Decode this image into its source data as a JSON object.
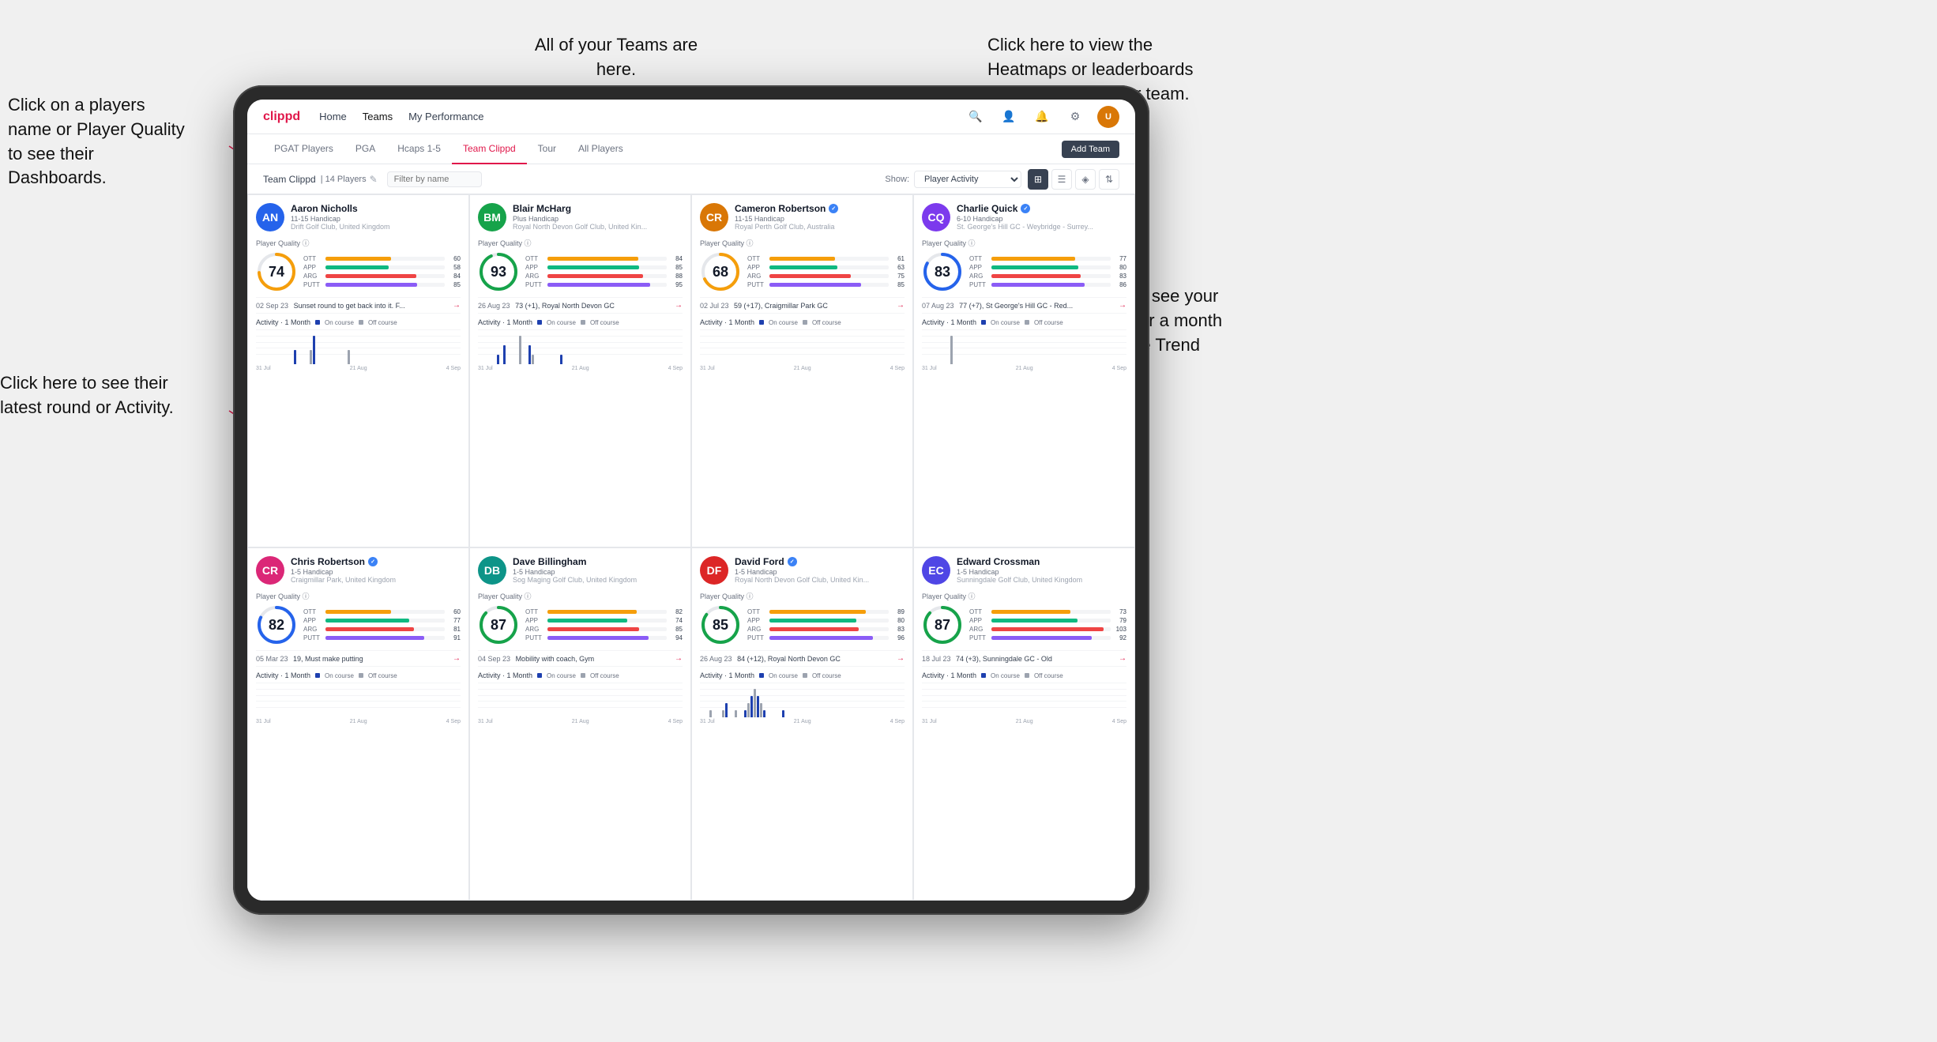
{
  "annotations": {
    "click_player": "Click on a players name\nor Player Quality to see\ntheir Dashboards.",
    "click_round": "Click here to see their latest\nround or Activity.",
    "teams_here": "All of your Teams are here.",
    "heatmaps": "Click here to view the\nHeatmaps or leaderboards\nand streaks for your team.",
    "activities": "Choose whether you see\nyour players Activities over\na month or their Quality\nScore Trend over a year."
  },
  "nav": {
    "logo": "clippd",
    "items": [
      "Home",
      "Teams",
      "My Performance"
    ],
    "active": "Teams"
  },
  "sub_tabs": {
    "items": [
      "PGAT Players",
      "PGA",
      "Hcaps 1-5",
      "Team Clippd",
      "Tour",
      "All Players"
    ],
    "active": "Team Clippd",
    "add_button": "Add Team"
  },
  "filter_bar": {
    "team_label": "Team Clippd",
    "separator": "|",
    "count": "14 Players",
    "search_placeholder": "Filter by name",
    "show_label": "Show:",
    "show_value": "Player Activity"
  },
  "players": [
    {
      "name": "Aaron Nicholls",
      "handicap": "11-15 Handicap",
      "club": "Drift Golf Club, United Kingdom",
      "verified": false,
      "quality": 74,
      "color": "#2563eb",
      "ott": 60,
      "app": 58,
      "arg": 84,
      "putt": 85,
      "recent_date": "02 Sep 23",
      "recent_text": "Sunset round to get back into it. F...",
      "bars": [
        0,
        0,
        0,
        0,
        0,
        0,
        0,
        0,
        0,
        0,
        0,
        0,
        1,
        0,
        0,
        0,
        0,
        1,
        2,
        0,
        0,
        0,
        0,
        0,
        0,
        0,
        0,
        0,
        0,
        1
      ],
      "chart_labels": [
        "31 Jul",
        "21 Aug",
        "4 Sep"
      ]
    },
    {
      "name": "Blair McHarg",
      "handicap": "Plus Handicap",
      "club": "Royal North Devon Golf Club, United Kin...",
      "verified": false,
      "quality": 93,
      "color": "#16a34a",
      "ott": 84,
      "app": 85,
      "arg": 88,
      "putt": 95,
      "recent_date": "26 Aug 23",
      "recent_text": "73 (+1), Royal North Devon GC",
      "bars": [
        0,
        0,
        0,
        0,
        0,
        0,
        1,
        0,
        2,
        0,
        0,
        0,
        0,
        3,
        0,
        0,
        2,
        1,
        0,
        0,
        0,
        0,
        0,
        0,
        0,
        0,
        1,
        0,
        0,
        0
      ],
      "chart_labels": [
        "31 Jul",
        "21 Aug",
        "4 Sep"
      ]
    },
    {
      "name": "Cameron Robertson",
      "handicap": "11-15 Handicap",
      "club": "Royal Perth Golf Club, Australia",
      "verified": true,
      "quality": 68,
      "color": "#2563eb",
      "ott": 61,
      "app": 63,
      "arg": 75,
      "putt": 85,
      "recent_date": "02 Jul 23",
      "recent_text": "59 (+17), Craigmillar Park GC",
      "bars": [
        0,
        0,
        0,
        0,
        0,
        0,
        0,
        0,
        0,
        0,
        0,
        0,
        0,
        0,
        0,
        0,
        0,
        0,
        0,
        0,
        0,
        0,
        0,
        0,
        0,
        0,
        0,
        0,
        0,
        0
      ],
      "chart_labels": [
        "31 Jul",
        "21 Aug",
        "4 Sep"
      ]
    },
    {
      "name": "Charlie Quick",
      "handicap": "6-10 Handicap",
      "club": "St. George's Hill GC - Weybridge - Surrey...",
      "verified": true,
      "quality": 83,
      "color": "#16a34a",
      "ott": 77,
      "app": 80,
      "arg": 83,
      "putt": 86,
      "recent_date": "07 Aug 23",
      "recent_text": "77 (+7), St George's Hill GC - Red...",
      "bars": [
        0,
        0,
        0,
        0,
        0,
        0,
        0,
        0,
        0,
        2,
        0,
        0,
        0,
        0,
        0,
        0,
        0,
        0,
        0,
        0,
        0,
        0,
        0,
        0,
        0,
        0,
        0,
        0,
        0,
        0
      ],
      "chart_labels": [
        "31 Jul",
        "21 Aug",
        "4 Sep"
      ]
    },
    {
      "name": "Chris Robertson",
      "handicap": "1-5 Handicap",
      "club": "Craigmillar Park, United Kingdom",
      "verified": true,
      "quality": 82,
      "color": "#16a34a",
      "ott": 60,
      "app": 77,
      "arg": 81,
      "putt": 91,
      "recent_date": "05 Mar 23",
      "recent_text": "19, Must make putting",
      "bars": [
        0,
        0,
        0,
        0,
        0,
        0,
        0,
        0,
        0,
        0,
        0,
        0,
        0,
        0,
        0,
        0,
        0,
        0,
        0,
        0,
        0,
        0,
        0,
        0,
        0,
        0,
        0,
        0,
        0,
        0
      ],
      "chart_labels": [
        "31 Jul",
        "21 Aug",
        "4 Sep"
      ]
    },
    {
      "name": "Dave Billingham",
      "handicap": "1-5 Handicap",
      "club": "Sog Maging Golf Club, United Kingdom",
      "verified": false,
      "quality": 87,
      "color": "#16a34a",
      "ott": 82,
      "app": 74,
      "arg": 85,
      "putt": 94,
      "recent_date": "04 Sep 23",
      "recent_text": "Mobility with coach, Gym",
      "bars": [
        0,
        0,
        0,
        0,
        0,
        0,
        0,
        0,
        0,
        0,
        0,
        0,
        0,
        0,
        0,
        0,
        0,
        0,
        0,
        0,
        0,
        0,
        0,
        0,
        0,
        0,
        0,
        0,
        0,
        0
      ],
      "chart_labels": [
        "31 Jul",
        "21 Aug",
        "4 Sep"
      ]
    },
    {
      "name": "David Ford",
      "handicap": "1-5 Handicap",
      "club": "Royal North Devon Golf Club, United Kin...",
      "verified": true,
      "quality": 85,
      "color": "#16a34a",
      "ott": 89,
      "app": 80,
      "arg": 83,
      "putt": 96,
      "recent_date": "26 Aug 23",
      "recent_text": "84 (+12), Royal North Devon GC",
      "bars": [
        0,
        0,
        0,
        1,
        0,
        0,
        0,
        1,
        2,
        0,
        0,
        1,
        0,
        0,
        1,
        2,
        3,
        4,
        3,
        2,
        1,
        0,
        0,
        0,
        0,
        0,
        1,
        0,
        0,
        0
      ],
      "chart_labels": [
        "31 Jul",
        "21 Aug",
        "4 Sep"
      ]
    },
    {
      "name": "Edward Crossman",
      "handicap": "1-5 Handicap",
      "club": "Sunningdale Golf Club, United Kingdom",
      "verified": false,
      "quality": 87,
      "color": "#16a34a",
      "ott": 73,
      "app": 79,
      "arg": 103,
      "putt": 92,
      "recent_date": "18 Jul 23",
      "recent_text": "74 (+3), Sunningdale GC - Old",
      "bars": [
        0,
        0,
        0,
        0,
        0,
        0,
        0,
        0,
        0,
        0,
        0,
        0,
        0,
        0,
        0,
        0,
        0,
        0,
        0,
        0,
        0,
        0,
        0,
        0,
        0,
        0,
        0,
        0,
        0,
        0
      ],
      "chart_labels": [
        "31 Jul",
        "21 Aug",
        "4 Sep"
      ]
    }
  ],
  "activity_label": "Activity",
  "month_label": "1 Month",
  "on_course_label": "On course",
  "off_course_label": "Off course",
  "on_course_color": "#1e40af",
  "off_course_color": "#9ca3af",
  "stat_colors": {
    "ott": "#f59e0b",
    "app": "#10b981",
    "arg": "#ef4444",
    "putt": "#8b5cf6"
  }
}
